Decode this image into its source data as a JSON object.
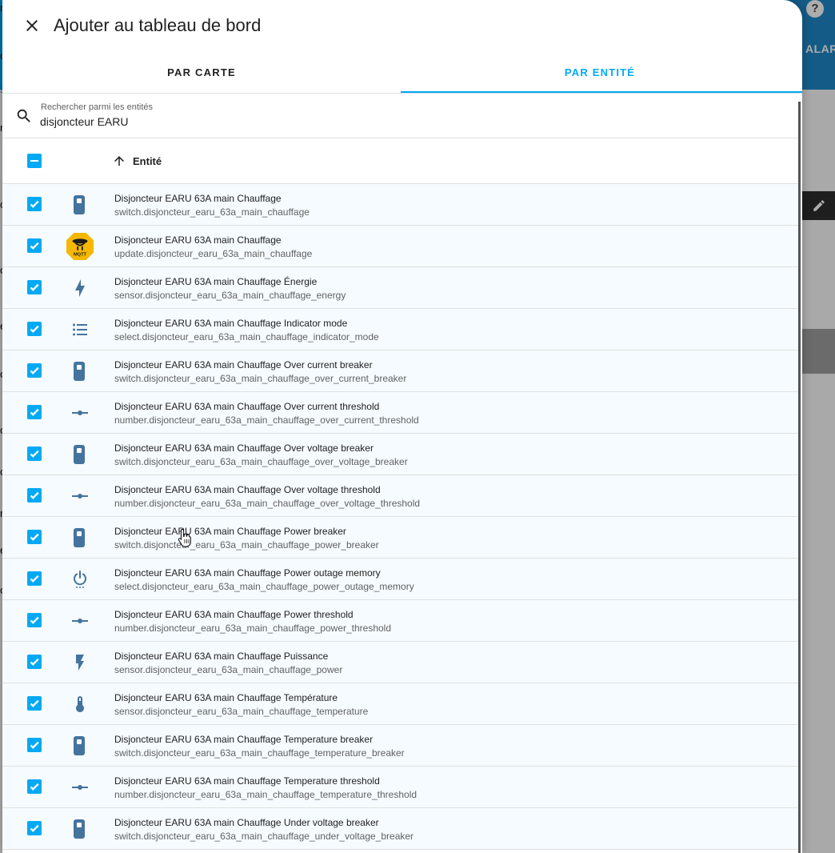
{
  "background": {
    "alarm_label": "ALAR",
    "help_label": "?",
    "left_letters": [
      "r",
      "o",
      "r",
      "c",
      "o",
      "e",
      "o",
      "c",
      "o",
      "r",
      "e",
      "o"
    ],
    "left_link": "s"
  },
  "dialog": {
    "title": "Ajouter au tableau de bord",
    "tabs": [
      {
        "label": "PAR CARTE",
        "active": false
      },
      {
        "label": "PAR ENTITÉ",
        "active": true
      }
    ],
    "search": {
      "label": "Rechercher parmi les entités",
      "value": "disjoncteur EARU"
    },
    "table": {
      "column_entity": "Entité",
      "rows": [
        {
          "name": "Disjoncteur EARU 63A main Chauffage",
          "entity_id": "switch.disjoncteur_earu_63a_main_chauffage",
          "icon": "switch-icon",
          "checked": true
        },
        {
          "name": "Disjoncteur EARU 63A main Chauffage",
          "entity_id": "update.disjoncteur_earu_63a_main_chauffage",
          "icon": "mqtt-logo-icon",
          "checked": true
        },
        {
          "name": "Disjoncteur EARU 63A main Chauffage Énergie",
          "entity_id": "sensor.disjoncteur_earu_63a_main_chauffage_energy",
          "icon": "lightning-bolt-icon",
          "checked": true
        },
        {
          "name": "Disjoncteur EARU 63A main Chauffage Indicator mode",
          "entity_id": "select.disjoncteur_earu_63a_main_chauffage_indicator_mode",
          "icon": "format-list-icon",
          "checked": true
        },
        {
          "name": "Disjoncteur EARU 63A main Chauffage Over current breaker",
          "entity_id": "switch.disjoncteur_earu_63a_main_chauffage_over_current_breaker",
          "icon": "switch-icon",
          "checked": true
        },
        {
          "name": "Disjoncteur EARU 63A main Chauffage Over current threshold",
          "entity_id": "number.disjoncteur_earu_63a_main_chauffage_over_current_threshold",
          "icon": "ray-vertex-icon",
          "checked": true
        },
        {
          "name": "Disjoncteur EARU 63A main Chauffage Over voltage breaker",
          "entity_id": "switch.disjoncteur_earu_63a_main_chauffage_over_voltage_breaker",
          "icon": "switch-icon",
          "checked": true
        },
        {
          "name": "Disjoncteur EARU 63A main Chauffage Over voltage threshold",
          "entity_id": "number.disjoncteur_earu_63a_main_chauffage_over_voltage_threshold",
          "icon": "ray-vertex-icon",
          "checked": true
        },
        {
          "name": "Disjoncteur EARU 63A main Chauffage Power breaker",
          "entity_id": "switch.disjoncteur_earu_63a_main_chauffage_power_breaker",
          "icon": "switch-icon",
          "checked": true
        },
        {
          "name": "Disjoncteur EARU 63A main Chauffage Power outage memory",
          "entity_id": "select.disjoncteur_earu_63a_main_chauffage_power_outage_memory",
          "icon": "power-settings-icon",
          "checked": true
        },
        {
          "name": "Disjoncteur EARU 63A main Chauffage Power threshold",
          "entity_id": "number.disjoncteur_earu_63a_main_chauffage_power_threshold",
          "icon": "ray-vertex-icon",
          "checked": true
        },
        {
          "name": "Disjoncteur EARU 63A main Chauffage Puissance",
          "entity_id": "sensor.disjoncteur_earu_63a_main_chauffage_power",
          "icon": "flash-icon",
          "checked": true
        },
        {
          "name": "Disjoncteur EARU 63A main Chauffage Température",
          "entity_id": "sensor.disjoncteur_earu_63a_main_chauffage_temperature",
          "icon": "thermometer-icon",
          "checked": true
        },
        {
          "name": "Disjoncteur EARU 63A main Chauffage Temperature breaker",
          "entity_id": "switch.disjoncteur_earu_63a_main_chauffage_temperature_breaker",
          "icon": "switch-icon",
          "checked": true
        },
        {
          "name": "Disjoncteur EARU 63A main Chauffage Temperature threshold",
          "entity_id": "number.disjoncteur_earu_63a_main_chauffage_temperature_threshold",
          "icon": "ray-vertex-icon",
          "checked": true
        },
        {
          "name": "Disjoncteur EARU 63A main Chauffage Under voltage breaker",
          "entity_id": "switch.disjoncteur_earu_63a_main_chauffage_under_voltage_breaker",
          "icon": "switch-icon",
          "checked": true
        }
      ]
    }
  },
  "colors": {
    "accent": "#03a9f4",
    "icon": "#44739e",
    "mqtt_badge": "#f5b700"
  }
}
